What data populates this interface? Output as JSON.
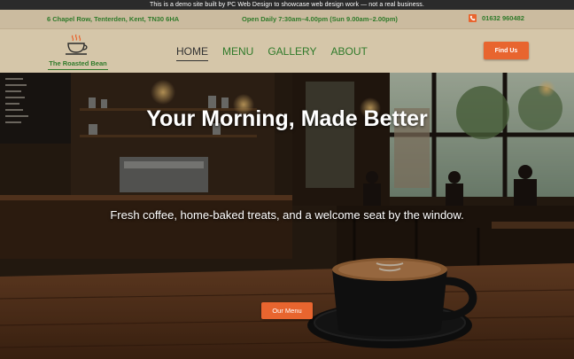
{
  "demo_banner": "This is a demo site built by PC Web Design to showcase web design work — not a real business.",
  "info_bar": {
    "address": "6 Chapel Row, Tenterden, Kent, TN30 6HA",
    "hours": "Open Daily 7:30am–4.00pm (Sun 9.00am–2.00pm)",
    "phone": "01632 960482",
    "phone_icon": "phone-icon"
  },
  "logo": {
    "text": "The Roasted Bean",
    "icon": "coffee-cup-icon"
  },
  "nav": {
    "items": [
      {
        "label": "HOME",
        "active": true
      },
      {
        "label": "MENU",
        "active": false
      },
      {
        "label": "GALLERY",
        "active": false
      },
      {
        "label": "ABOUT",
        "active": false
      }
    ]
  },
  "header_cta": "Find Us",
  "hero": {
    "title": "Your Morning, Made Better",
    "subtitle": "Fresh coffee, home-baked treats, and a welcome seat by the window.",
    "cta": "Our Menu"
  },
  "colors": {
    "accent": "#e8652f",
    "brand_green": "#2f7a2a",
    "header_bg": "#d5c6a9",
    "demo_bar_bg": "#2b2b2b"
  }
}
